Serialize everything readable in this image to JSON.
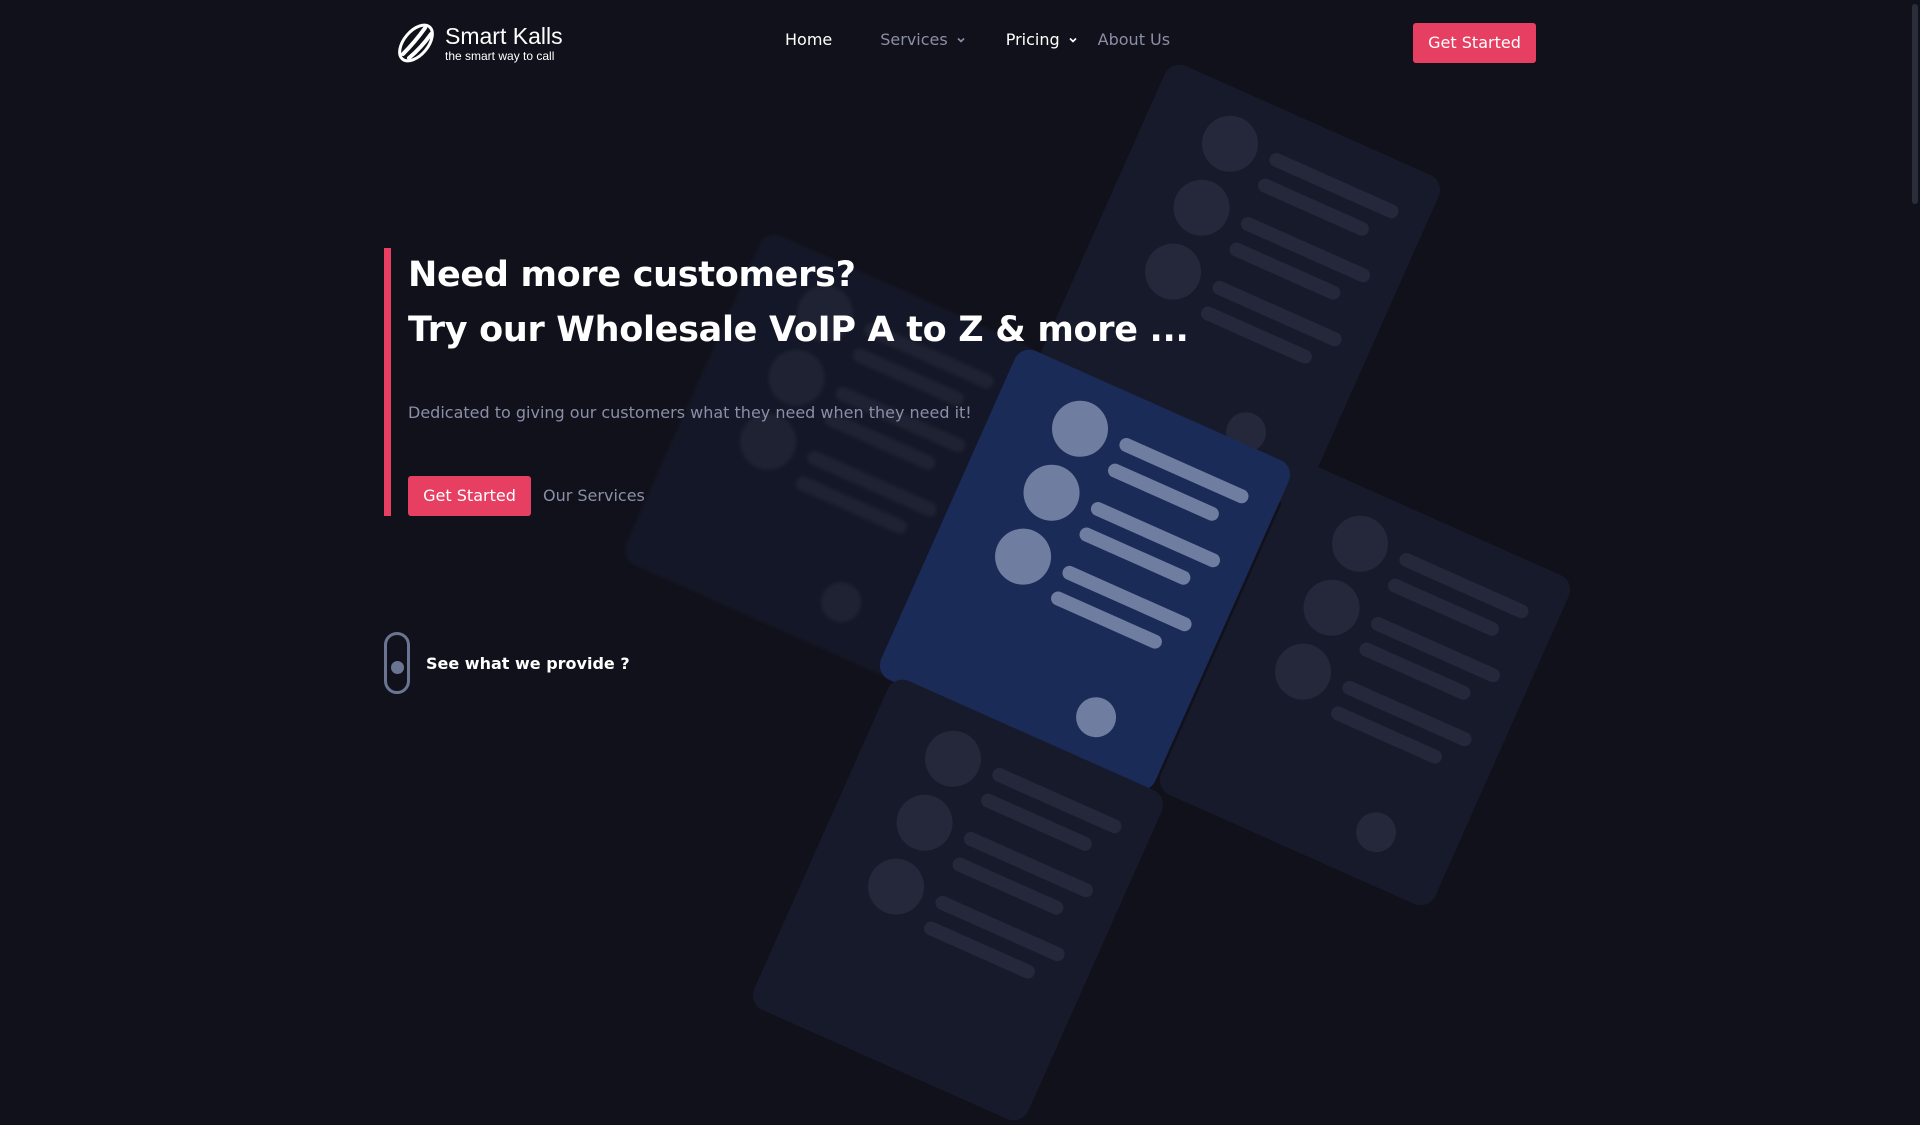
{
  "brand": {
    "name": "Smart Kalls",
    "tagline": "the smart way to call"
  },
  "nav": {
    "items": [
      {
        "label": "Home",
        "dropdown": false
      },
      {
        "label": "Services",
        "dropdown": true
      },
      {
        "label": "Pricing",
        "dropdown": true
      },
      {
        "label": "About Us",
        "dropdown": false
      }
    ]
  },
  "header": {
    "cta_label": "Get Started"
  },
  "hero": {
    "title_line1": "Need more customers?",
    "title_line2": "Try our Wholesale VoIP A to Z & more ...",
    "subtitle": "Dedicated to giving our customers what they need when they need it!",
    "cta_label": "Get Started",
    "secondary_label": "Our Services"
  },
  "scroll_hint": {
    "label": "See what we provide ?"
  },
  "colors": {
    "background": "#11111b",
    "accent": "#e63f62",
    "muted_text": "#8a8fa8",
    "card": "#161a2b",
    "card_highlight": "#1b2b57"
  },
  "icons": {
    "logo": "smart-kalls-logo-mark",
    "dropdown": "chevron-down-icon",
    "scroll": "mouse-scroll-icon"
  }
}
